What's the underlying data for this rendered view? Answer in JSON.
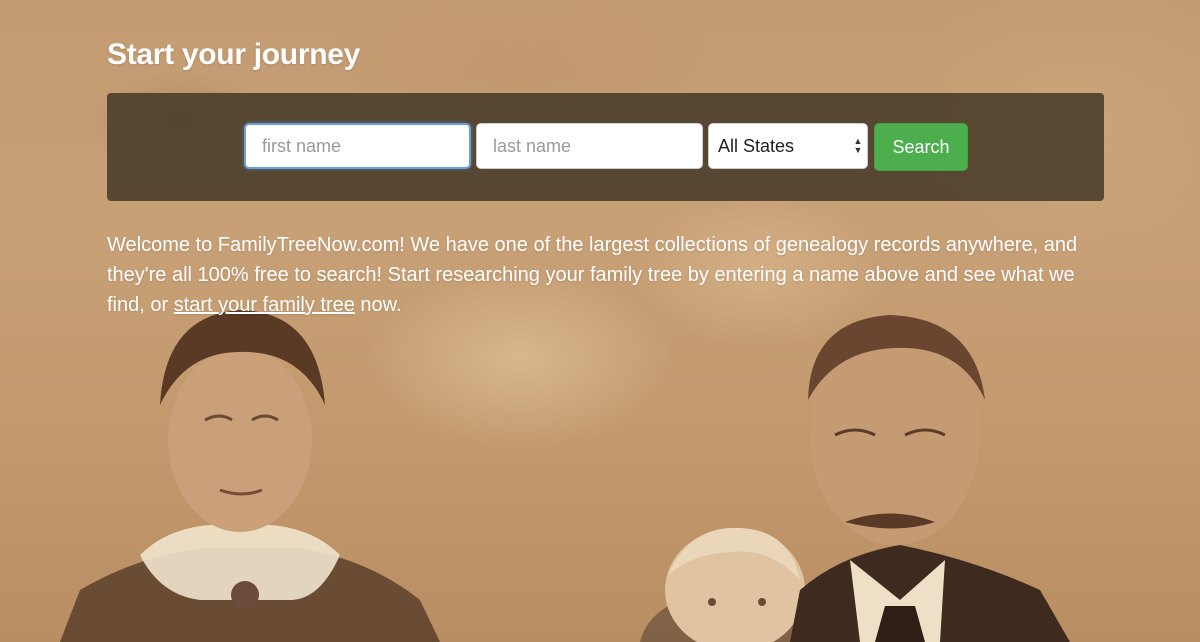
{
  "hero": {
    "title": "Start your journey"
  },
  "search": {
    "first_name_placeholder": "first name",
    "last_name_placeholder": "last name",
    "state_selected": "All States",
    "button_label": "Search"
  },
  "intro": {
    "text_before": "Welcome to FamilyTreeNow.com! We have one of the largest collections of genealogy records anywhere, and they're all 100% free to search! Start researching your family tree by entering a name above and see what we find, or ",
    "link_text": "start your family tree",
    "text_after": " now."
  },
  "colors": {
    "panel": "#483a28",
    "button": "#4cae4c",
    "background": "#c49c72"
  }
}
